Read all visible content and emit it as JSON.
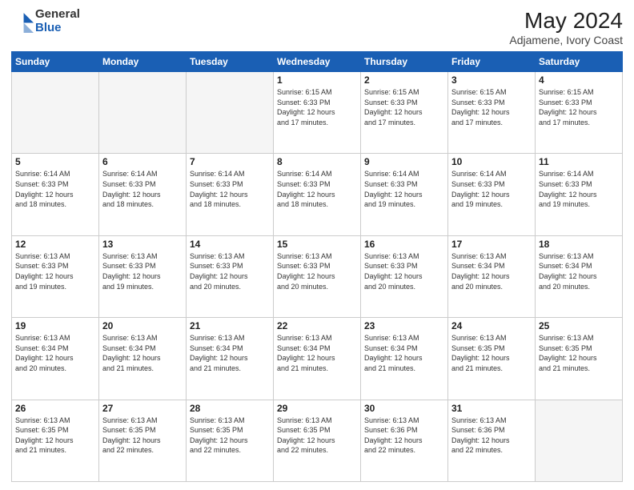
{
  "header": {
    "logo_general": "General",
    "logo_blue": "Blue",
    "title": "May 2024",
    "location": "Adjamene, Ivory Coast"
  },
  "days_of_week": [
    "Sunday",
    "Monday",
    "Tuesday",
    "Wednesday",
    "Thursday",
    "Friday",
    "Saturday"
  ],
  "weeks": [
    [
      {
        "day": "",
        "info": ""
      },
      {
        "day": "",
        "info": ""
      },
      {
        "day": "",
        "info": ""
      },
      {
        "day": "1",
        "info": "Sunrise: 6:15 AM\nSunset: 6:33 PM\nDaylight: 12 hours\nand 17 minutes."
      },
      {
        "day": "2",
        "info": "Sunrise: 6:15 AM\nSunset: 6:33 PM\nDaylight: 12 hours\nand 17 minutes."
      },
      {
        "day": "3",
        "info": "Sunrise: 6:15 AM\nSunset: 6:33 PM\nDaylight: 12 hours\nand 17 minutes."
      },
      {
        "day": "4",
        "info": "Sunrise: 6:15 AM\nSunset: 6:33 PM\nDaylight: 12 hours\nand 17 minutes."
      }
    ],
    [
      {
        "day": "5",
        "info": "Sunrise: 6:14 AM\nSunset: 6:33 PM\nDaylight: 12 hours\nand 18 minutes."
      },
      {
        "day": "6",
        "info": "Sunrise: 6:14 AM\nSunset: 6:33 PM\nDaylight: 12 hours\nand 18 minutes."
      },
      {
        "day": "7",
        "info": "Sunrise: 6:14 AM\nSunset: 6:33 PM\nDaylight: 12 hours\nand 18 minutes."
      },
      {
        "day": "8",
        "info": "Sunrise: 6:14 AM\nSunset: 6:33 PM\nDaylight: 12 hours\nand 18 minutes."
      },
      {
        "day": "9",
        "info": "Sunrise: 6:14 AM\nSunset: 6:33 PM\nDaylight: 12 hours\nand 19 minutes."
      },
      {
        "day": "10",
        "info": "Sunrise: 6:14 AM\nSunset: 6:33 PM\nDaylight: 12 hours\nand 19 minutes."
      },
      {
        "day": "11",
        "info": "Sunrise: 6:14 AM\nSunset: 6:33 PM\nDaylight: 12 hours\nand 19 minutes."
      }
    ],
    [
      {
        "day": "12",
        "info": "Sunrise: 6:13 AM\nSunset: 6:33 PM\nDaylight: 12 hours\nand 19 minutes."
      },
      {
        "day": "13",
        "info": "Sunrise: 6:13 AM\nSunset: 6:33 PM\nDaylight: 12 hours\nand 19 minutes."
      },
      {
        "day": "14",
        "info": "Sunrise: 6:13 AM\nSunset: 6:33 PM\nDaylight: 12 hours\nand 20 minutes."
      },
      {
        "day": "15",
        "info": "Sunrise: 6:13 AM\nSunset: 6:33 PM\nDaylight: 12 hours\nand 20 minutes."
      },
      {
        "day": "16",
        "info": "Sunrise: 6:13 AM\nSunset: 6:33 PM\nDaylight: 12 hours\nand 20 minutes."
      },
      {
        "day": "17",
        "info": "Sunrise: 6:13 AM\nSunset: 6:34 PM\nDaylight: 12 hours\nand 20 minutes."
      },
      {
        "day": "18",
        "info": "Sunrise: 6:13 AM\nSunset: 6:34 PM\nDaylight: 12 hours\nand 20 minutes."
      }
    ],
    [
      {
        "day": "19",
        "info": "Sunrise: 6:13 AM\nSunset: 6:34 PM\nDaylight: 12 hours\nand 20 minutes."
      },
      {
        "day": "20",
        "info": "Sunrise: 6:13 AM\nSunset: 6:34 PM\nDaylight: 12 hours\nand 21 minutes."
      },
      {
        "day": "21",
        "info": "Sunrise: 6:13 AM\nSunset: 6:34 PM\nDaylight: 12 hours\nand 21 minutes."
      },
      {
        "day": "22",
        "info": "Sunrise: 6:13 AM\nSunset: 6:34 PM\nDaylight: 12 hours\nand 21 minutes."
      },
      {
        "day": "23",
        "info": "Sunrise: 6:13 AM\nSunset: 6:34 PM\nDaylight: 12 hours\nand 21 minutes."
      },
      {
        "day": "24",
        "info": "Sunrise: 6:13 AM\nSunset: 6:35 PM\nDaylight: 12 hours\nand 21 minutes."
      },
      {
        "day": "25",
        "info": "Sunrise: 6:13 AM\nSunset: 6:35 PM\nDaylight: 12 hours\nand 21 minutes."
      }
    ],
    [
      {
        "day": "26",
        "info": "Sunrise: 6:13 AM\nSunset: 6:35 PM\nDaylight: 12 hours\nand 21 minutes."
      },
      {
        "day": "27",
        "info": "Sunrise: 6:13 AM\nSunset: 6:35 PM\nDaylight: 12 hours\nand 22 minutes."
      },
      {
        "day": "28",
        "info": "Sunrise: 6:13 AM\nSunset: 6:35 PM\nDaylight: 12 hours\nand 22 minutes."
      },
      {
        "day": "29",
        "info": "Sunrise: 6:13 AM\nSunset: 6:35 PM\nDaylight: 12 hours\nand 22 minutes."
      },
      {
        "day": "30",
        "info": "Sunrise: 6:13 AM\nSunset: 6:36 PM\nDaylight: 12 hours\nand 22 minutes."
      },
      {
        "day": "31",
        "info": "Sunrise: 6:13 AM\nSunset: 6:36 PM\nDaylight: 12 hours\nand 22 minutes."
      },
      {
        "day": "",
        "info": ""
      }
    ]
  ]
}
